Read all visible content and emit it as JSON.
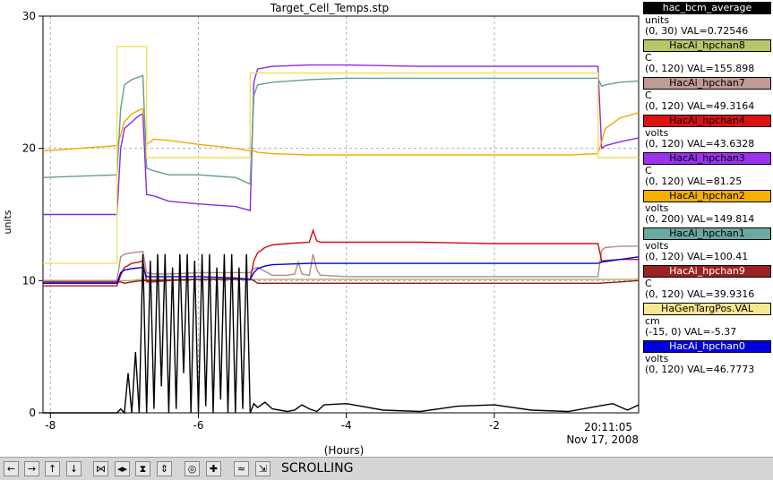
{
  "chart_data": {
    "type": "line",
    "title": "Target_Cell_Temps.stp",
    "xlabel": "(Hours)",
    "ylabel": "units",
    "xlim": [
      -8.1,
      -0.05
    ],
    "ylim": [
      0,
      30
    ],
    "x_ticks": [
      -8,
      -6,
      -4,
      -2
    ],
    "y_ticks": [
      0,
      10,
      20,
      30
    ],
    "grid": true,
    "timestamp_time": "20:11:05",
    "timestamp_date": "Nov 17, 2008",
    "series": [
      {
        "name": "hac_bcm_average",
        "color": "#000000",
        "x": [
          -8.1,
          -7.1,
          -7.05,
          -7.0,
          -6.95,
          -6.9,
          -6.85,
          -6.8,
          -6.75,
          -6.7,
          -6.65,
          -6.6,
          -6.55,
          -6.5,
          -6.45,
          -6.4,
          -6.35,
          -6.3,
          -6.25,
          -6.2,
          -6.15,
          -6.1,
          -6.05,
          -6.0,
          -5.95,
          -5.9,
          -5.85,
          -5.8,
          -5.75,
          -5.7,
          -5.65,
          -5.6,
          -5.55,
          -5.5,
          -5.45,
          -5.4,
          -5.35,
          -5.3,
          -5.25,
          -5.2,
          -5.1,
          -5.0,
          -4.9,
          -4.8,
          -4.7,
          -4.6,
          -4.5,
          -4.4,
          -4.3,
          -4.0,
          -3.5,
          -3.0,
          -2.5,
          -2.0,
          -1.5,
          -1.0,
          -0.6,
          -0.4,
          -0.2,
          -0.05
        ],
        "y": [
          0,
          0,
          0.3,
          0,
          3,
          0,
          4.6,
          0,
          12,
          0,
          11.5,
          0.3,
          12,
          2,
          12,
          0,
          11,
          0.3,
          12,
          3,
          12,
          0,
          11.5,
          0,
          12,
          0.5,
          12,
          0,
          11,
          1,
          12,
          0,
          12,
          0,
          11,
          0.3,
          12,
          0,
          0.7,
          0.4,
          0.8,
          0.3,
          0.2,
          0.1,
          0.2,
          0.6,
          0.3,
          0.1,
          0.6,
          0.7,
          0.2,
          0.1,
          0.5,
          0.6,
          0.2,
          0.1,
          0.5,
          0.7,
          0.2,
          0.6
        ]
      },
      {
        "name": "HacAi_hpchan8",
        "color": "#a8b060",
        "x": [
          -8.1,
          -7.1,
          -7.0,
          -6.9,
          -6.8,
          -6.75,
          -6.7,
          -6.6,
          -6.4,
          -6.0,
          -5.5,
          -5.3,
          -5.25,
          -5.2,
          -5.0,
          -4.5,
          -4.0,
          -3.0,
          -2.0,
          -1.0,
          -0.6,
          -0.55,
          -0.5,
          -0.3,
          -0.05
        ],
        "y": [
          10.0,
          10.0,
          10.0,
          10.0,
          10.1,
          10.1,
          10.1,
          10.1,
          10.1,
          10.1,
          10.1,
          10.1,
          10.1,
          10.1,
          10.1,
          10.1,
          10.1,
          10.1,
          10.1,
          10.1,
          10.1,
          10.1,
          10.1,
          10.1,
          10.1
        ]
      },
      {
        "name": "HacAi_hpchan7",
        "color": "#b48a84",
        "x": [
          -8.1,
          -7.1,
          -7.05,
          -7.0,
          -6.9,
          -6.75,
          -6.7,
          -6.6,
          -6.4,
          -6.0,
          -5.5,
          -5.3,
          -5.25,
          -5.2,
          -5.0,
          -4.8,
          -4.7,
          -4.65,
          -4.6,
          -4.5,
          -4.45,
          -4.4,
          -4.35,
          -4.3,
          -4.0,
          -3.0,
          -2.0,
          -1.0,
          -0.6,
          -0.55,
          -0.5,
          -0.3,
          -0.05
        ],
        "y": [
          10.0,
          10.0,
          11.8,
          12.0,
          12.1,
          12.2,
          10.6,
          10.5,
          10.5,
          10.6,
          10.6,
          10.6,
          10.9,
          11.0,
          10.4,
          10.4,
          10.5,
          11.4,
          10.5,
          10.4,
          12.0,
          10.8,
          10.4,
          10.4,
          10.3,
          10.3,
          10.3,
          10.3,
          10.3,
          12.3,
          12.5,
          12.6,
          12.6
        ]
      },
      {
        "name": "HacAi_hpchan4",
        "color": "#cc1010",
        "x": [
          -8.1,
          -7.1,
          -7.05,
          -7.0,
          -6.9,
          -6.8,
          -6.75,
          -6.7,
          -6.6,
          -6.4,
          -6.0,
          -5.5,
          -5.3,
          -5.25,
          -5.2,
          -5.1,
          -5.0,
          -4.8,
          -4.5,
          -4.45,
          -4.4,
          -4.35,
          -4.3,
          -4.0,
          -3.0,
          -2.0,
          -1.0,
          -0.6,
          -0.55,
          -0.3,
          -0.05
        ],
        "y": [
          9.6,
          9.6,
          10.4,
          11.0,
          11.3,
          11.4,
          11.5,
          9.9,
          9.9,
          10.0,
          10.1,
          10.1,
          10.1,
          11.5,
          12.1,
          12.5,
          12.7,
          12.8,
          12.9,
          13.8,
          13.0,
          12.9,
          12.9,
          12.9,
          12.9,
          12.8,
          12.8,
          12.8,
          11.5,
          11.6,
          11.6
        ]
      },
      {
        "name": "HacAi_hpchan3",
        "color": "#8a2be2",
        "x": [
          -8.1,
          -7.1,
          -7.05,
          -7.0,
          -6.9,
          -6.8,
          -6.75,
          -6.7,
          -6.6,
          -6.4,
          -6.0,
          -5.5,
          -5.3,
          -5.25,
          -5.2,
          -5.0,
          -4.5,
          -4.0,
          -3.0,
          -2.0,
          -1.0,
          -0.6,
          -0.55,
          -0.5,
          -0.3,
          -0.05
        ],
        "y": [
          15.0,
          15.0,
          20.0,
          21.5,
          22.0,
          22.5,
          22.6,
          16.5,
          16.4,
          16.0,
          15.8,
          15.6,
          15.3,
          25.0,
          26.0,
          26.2,
          26.3,
          26.3,
          26.2,
          26.2,
          26.2,
          26.2,
          20.0,
          20.2,
          20.5,
          20.8
        ]
      },
      {
        "name": "HacAi_hpchan2",
        "color": "#f5a800",
        "x": [
          -8.1,
          -7.1,
          -7.05,
          -7.0,
          -6.9,
          -6.8,
          -6.75,
          -6.7,
          -6.6,
          -6.4,
          -6.0,
          -5.5,
          -5.3,
          -5.25,
          -5.2,
          -5.0,
          -4.5,
          -4.0,
          -3.0,
          -2.0,
          -1.0,
          -0.6,
          -0.55,
          -0.5,
          -0.3,
          -0.05
        ],
        "y": [
          19.8,
          20.2,
          21.0,
          22.0,
          22.6,
          22.9,
          23.0,
          20.3,
          20.7,
          20.6,
          20.3,
          20.0,
          19.8,
          19.8,
          19.7,
          19.6,
          19.5,
          19.5,
          19.5,
          19.5,
          19.5,
          19.6,
          20.5,
          21.5,
          22.3,
          22.7
        ]
      },
      {
        "name": "HacAi_hpchan1",
        "color": "#5f9e96",
        "x": [
          -8.1,
          -7.1,
          -7.05,
          -7.0,
          -6.9,
          -6.8,
          -6.75,
          -6.7,
          -6.6,
          -6.4,
          -6.0,
          -5.5,
          -5.3,
          -5.25,
          -5.2,
          -5.0,
          -4.5,
          -4.0,
          -3.0,
          -2.0,
          -1.0,
          -0.6,
          -0.55,
          -0.5,
          -0.3,
          -0.05
        ],
        "y": [
          17.8,
          18.0,
          23.0,
          24.8,
          25.2,
          25.4,
          25.5,
          18.5,
          18.3,
          18.0,
          18.0,
          17.8,
          17.3,
          24.0,
          24.8,
          25.0,
          25.2,
          25.3,
          25.3,
          25.3,
          25.3,
          25.3,
          24.7,
          24.8,
          25.0,
          25.1
        ]
      },
      {
        "name": "HacAi_hpchan9",
        "color": "#8b1a1a",
        "x": [
          -8.1,
          -7.1,
          -7.05,
          -7.0,
          -6.9,
          -6.75,
          -6.7,
          -6.6,
          -6.0,
          -5.5,
          -5.3,
          -5.25,
          -5.2,
          -5.0,
          -4.0,
          -3.0,
          -2.0,
          -1.0,
          -0.6,
          -0.3,
          -0.05
        ],
        "y": [
          9.9,
          9.9,
          9.9,
          9.8,
          9.9,
          10.0,
          10.0,
          10.0,
          10.1,
          10.1,
          10.1,
          10.0,
          9.8,
          9.8,
          9.8,
          9.8,
          9.8,
          9.8,
          9.8,
          9.9,
          10.0
        ]
      },
      {
        "name": "HaGenTargPos.VAL",
        "color": "#f0e060",
        "x": [
          -8.1,
          -7.1,
          -7.1,
          -6.7,
          -6.7,
          -5.3,
          -5.3,
          -0.6,
          -0.6,
          -0.05
        ],
        "y": [
          11.3,
          11.3,
          27.7,
          27.7,
          19.3,
          19.3,
          25.7,
          25.7,
          19.3,
          19.3
        ]
      },
      {
        "name": "HacAi_hpchan0",
        "color": "#0000dd",
        "x": [
          -8.1,
          -7.1,
          -7.05,
          -7.0,
          -6.9,
          -6.75,
          -6.7,
          -6.6,
          -6.0,
          -5.5,
          -5.3,
          -5.25,
          -5.2,
          -5.1,
          -5.0,
          -4.5,
          -4.0,
          -3.0,
          -2.0,
          -1.0,
          -0.6,
          -0.55,
          -0.3,
          -0.05
        ],
        "y": [
          9.8,
          9.8,
          10.6,
          10.8,
          10.9,
          11.0,
          10.3,
          10.3,
          10.3,
          10.2,
          10.1,
          10.6,
          10.9,
          11.1,
          11.2,
          11.3,
          11.3,
          11.3,
          11.3,
          11.3,
          11.3,
          11.4,
          11.6,
          11.8
        ]
      }
    ]
  },
  "legend": [
    {
      "name": "hac_bcm_average",
      "unit": "units",
      "range": "(0, 30) VAL=0.72546",
      "color": "#000000",
      "text_color": "#ffffff"
    },
    {
      "name": "HacAi_hpchan8",
      "unit": "C",
      "range": "(0, 120) VAL=155.898",
      "color": "#b8c66a",
      "text_color": "#000000"
    },
    {
      "name": "HacAi_hpchan7",
      "unit": "C",
      "range": "(0, 120) VAL=49.3164",
      "color": "#c09a94",
      "text_color": "#000000"
    },
    {
      "name": "HacAi_hpchan4",
      "unit": "volts",
      "range": "(0, 120) VAL=43.6328",
      "color": "#dd1111",
      "text_color": "#000000"
    },
    {
      "name": "HacAi_hpchan3",
      "unit": "C",
      "range": "(0, 120) VAL=81.25",
      "color": "#9933ee",
      "text_color": "#000000"
    },
    {
      "name": "HacAi_hpchan2",
      "unit": "volts",
      "range": "(0, 200) VAL=149.814",
      "color": "#f5b000",
      "text_color": "#000000"
    },
    {
      "name": "HacAi_hpchan1",
      "unit": "volts",
      "range": "(0, 120) VAL=100.41",
      "color": "#6aa8a0",
      "text_color": "#000000"
    },
    {
      "name": "HacAi_hpchan9",
      "unit": "C",
      "range": "(0, 120) VAL=39.9316",
      "color": "#9a2222",
      "text_color": "#ffffff"
    },
    {
      "name": "HaGenTargPos.VAL",
      "unit": "cm",
      "range": "(-15, 0) VAL=-5.37",
      "color": "#f5e890",
      "text_color": "#000000"
    },
    {
      "name": "HacAi_hpchan0",
      "unit": "volts",
      "range": "(0, 120) VAL=46.7773",
      "color": "#0000dd",
      "text_color": "#ffffff"
    }
  ],
  "toolbar": {
    "status_label": "SCROLLING",
    "buttons": [
      {
        "icon": "arrow-left-icon",
        "glyph": "←"
      },
      {
        "icon": "arrow-right-icon",
        "glyph": "→"
      },
      {
        "icon": "arrow-up-icon",
        "glyph": "↑"
      },
      {
        "icon": "arrow-down-icon",
        "glyph": "↓"
      },
      {
        "icon": "zoom-in-horizontal-icon",
        "glyph": "⋈"
      },
      {
        "icon": "zoom-out-horizontal-icon",
        "glyph": "◂▸"
      },
      {
        "icon": "zoom-in-vertical-icon",
        "glyph": "⧗"
      },
      {
        "icon": "zoom-out-vertical-icon",
        "glyph": "⇕"
      },
      {
        "icon": "circle-icon",
        "glyph": "◎"
      },
      {
        "icon": "plus-icon",
        "glyph": "✚"
      },
      {
        "icon": "fit-icon",
        "glyph": "≈"
      },
      {
        "icon": "export-icon",
        "glyph": "⇲"
      }
    ]
  }
}
